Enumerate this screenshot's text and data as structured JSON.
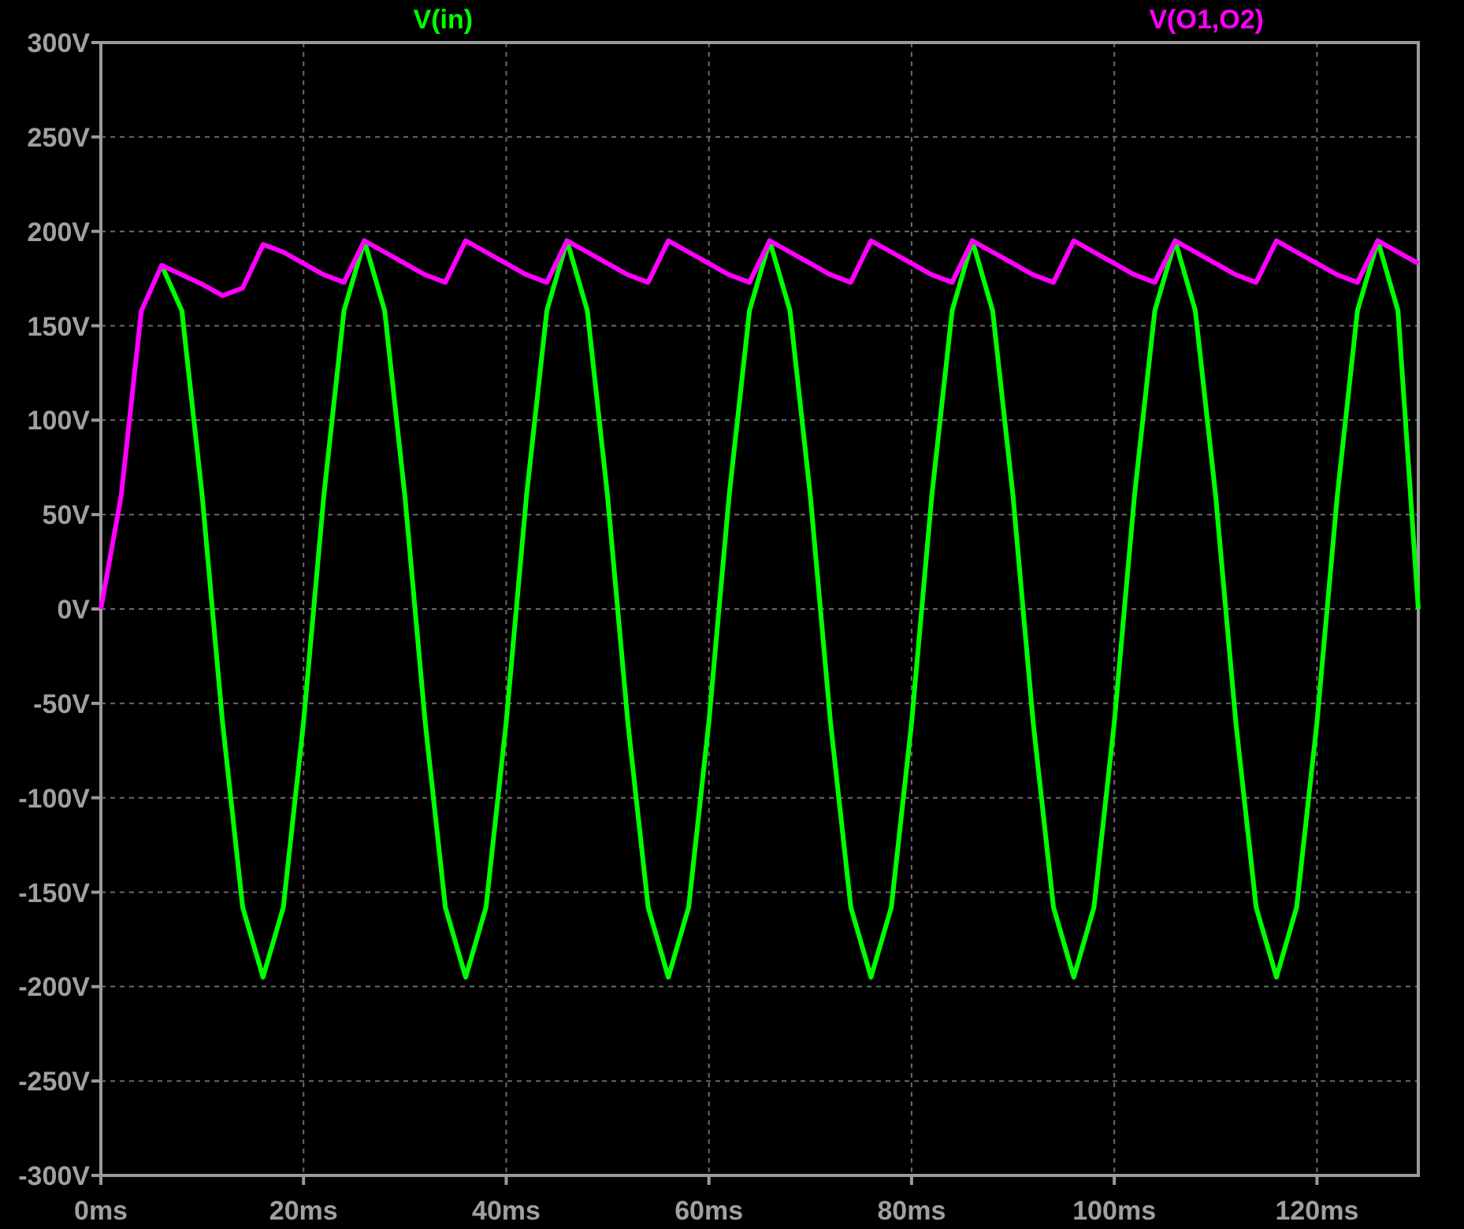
{
  "chart_data": {
    "type": "line",
    "x": [
      0,
      2,
      4,
      6,
      8,
      10,
      12,
      14,
      16,
      18,
      20,
      22,
      24,
      26,
      28,
      30,
      32,
      34,
      36,
      38,
      40,
      42,
      44,
      46,
      48,
      50,
      52,
      54,
      56,
      58,
      60,
      62,
      64,
      66,
      68,
      70,
      72,
      74,
      76,
      78,
      80,
      82,
      84,
      86,
      88,
      90,
      92,
      94,
      96,
      98,
      100,
      102,
      104,
      106,
      108,
      110,
      112,
      114,
      116,
      118,
      120,
      122,
      124,
      126,
      128,
      130
    ],
    "series": [
      {
        "name": "V(in)",
        "color": "#00ff00",
        "values": [
          null,
          null,
          null,
          182,
          158,
          60,
          -60,
          -158,
          -195,
          -158,
          -60,
          60,
          158,
          195,
          158,
          60,
          -60,
          -158,
          -195,
          -158,
          -60,
          60,
          158,
          195,
          158,
          60,
          -60,
          -158,
          -195,
          -158,
          -60,
          60,
          158,
          195,
          158,
          60,
          -60,
          -158,
          -195,
          -158,
          -60,
          60,
          158,
          195,
          158,
          60,
          -60,
          -158,
          -195,
          -158,
          -60,
          60,
          158,
          195,
          158,
          60,
          -60,
          -158,
          -195,
          -158,
          -60,
          60,
          158,
          195,
          158,
          0
        ]
      },
      {
        "name": "V(O1,O2)",
        "color": "#ff00ff",
        "values": [
          0,
          60,
          158,
          182,
          177,
          172,
          166,
          170,
          193,
          189,
          183,
          177,
          173,
          195,
          189,
          183,
          177,
          173,
          195,
          189,
          183,
          177,
          173,
          195,
          189,
          183,
          177,
          173,
          195,
          189,
          183,
          177,
          173,
          195,
          189,
          183,
          177,
          173,
          195,
          189,
          183,
          177,
          173,
          195,
          189,
          183,
          177,
          173,
          195,
          189,
          183,
          177,
          173,
          195,
          189,
          183,
          177,
          173,
          195,
          189,
          183,
          177,
          173,
          195,
          189,
          183
        ]
      }
    ],
    "grid": true,
    "xlim": [
      0,
      130
    ],
    "ylim": [
      -300,
      300
    ],
    "xticks": [
      {
        "value": 0,
        "label": "0ms"
      },
      {
        "value": 20,
        "label": "20ms"
      },
      {
        "value": 40,
        "label": "40ms"
      },
      {
        "value": 60,
        "label": "60ms"
      },
      {
        "value": 80,
        "label": "80ms"
      },
      {
        "value": 100,
        "label": "100ms"
      },
      {
        "value": 120,
        "label": "120ms"
      }
    ],
    "yticks": [
      {
        "value": 300,
        "label": "300V"
      },
      {
        "value": 250,
        "label": "250V"
      },
      {
        "value": 200,
        "label": "200V"
      },
      {
        "value": 150,
        "label": "150V"
      },
      {
        "value": 100,
        "label": "100V"
      },
      {
        "value": 50,
        "label": "50V"
      },
      {
        "value": 0,
        "label": "0V"
      },
      {
        "value": -50,
        "label": "-50V"
      },
      {
        "value": -100,
        "label": "-100V"
      },
      {
        "value": -150,
        "label": "-150V"
      },
      {
        "value": -200,
        "label": "-200V"
      },
      {
        "value": -250,
        "label": "-250V"
      },
      {
        "value": -300,
        "label": "-300V"
      }
    ]
  }
}
